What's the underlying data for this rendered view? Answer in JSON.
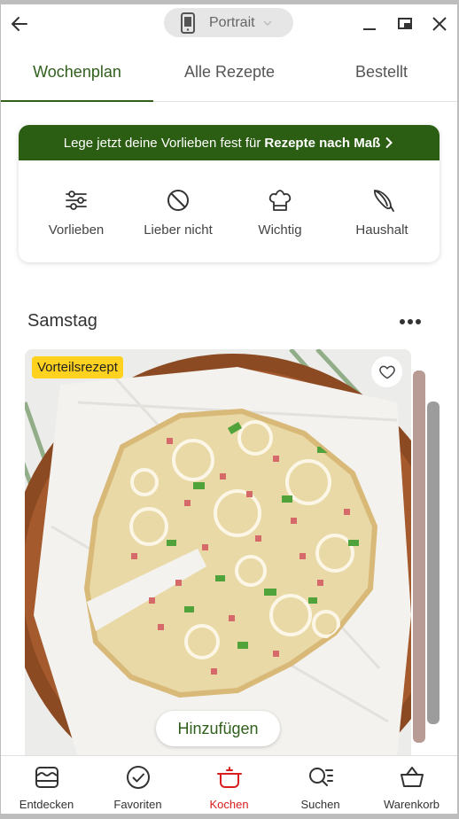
{
  "titlebar": {
    "device_label": "Portrait",
    "icons": [
      "arrow-left-icon",
      "phone-icon",
      "chevron-down-icon",
      "minimize-icon",
      "restore-icon",
      "close-icon"
    ]
  },
  "tabs": [
    {
      "label": "Wochenplan",
      "active": true
    },
    {
      "label": "Alle Rezepte",
      "active": false
    },
    {
      "label": "Bestellt",
      "active": false
    }
  ],
  "preferences": {
    "banner_prefix": "Lege jetzt deine Vorlieben fest für",
    "banner_bold": "Rezepte nach Maß",
    "items": [
      {
        "label": "Vorlieben",
        "icon": "sliders-icon"
      },
      {
        "label": "Lieber nicht",
        "icon": "prohibited-icon"
      },
      {
        "label": "Wichtig",
        "icon": "chef-hat-icon"
      },
      {
        "label": "Haushalt",
        "icon": "whisk-icon"
      }
    ]
  },
  "day": {
    "title": "Samstag",
    "recipe": {
      "badge": "Vorteilsrezept",
      "add_label": "Hinzufügen",
      "image": "flammkuchen-photo"
    }
  },
  "bottom_nav": [
    {
      "label": "Entdecken",
      "icon": "discover-icon",
      "active": false
    },
    {
      "label": "Favoriten",
      "icon": "check-circle-icon",
      "active": false
    },
    {
      "label": "Kochen",
      "icon": "cooking-pot-icon",
      "active": true
    },
    {
      "label": "Suchen",
      "icon": "search-list-icon",
      "active": false
    },
    {
      "label": "Warenkorb",
      "icon": "basket-icon",
      "active": false
    }
  ],
  "colors": {
    "brand_green": "#2b5e12",
    "tab_green": "#2f5f1b",
    "badge_yellow": "#ffd21f",
    "active_red": "#d81e1e"
  }
}
